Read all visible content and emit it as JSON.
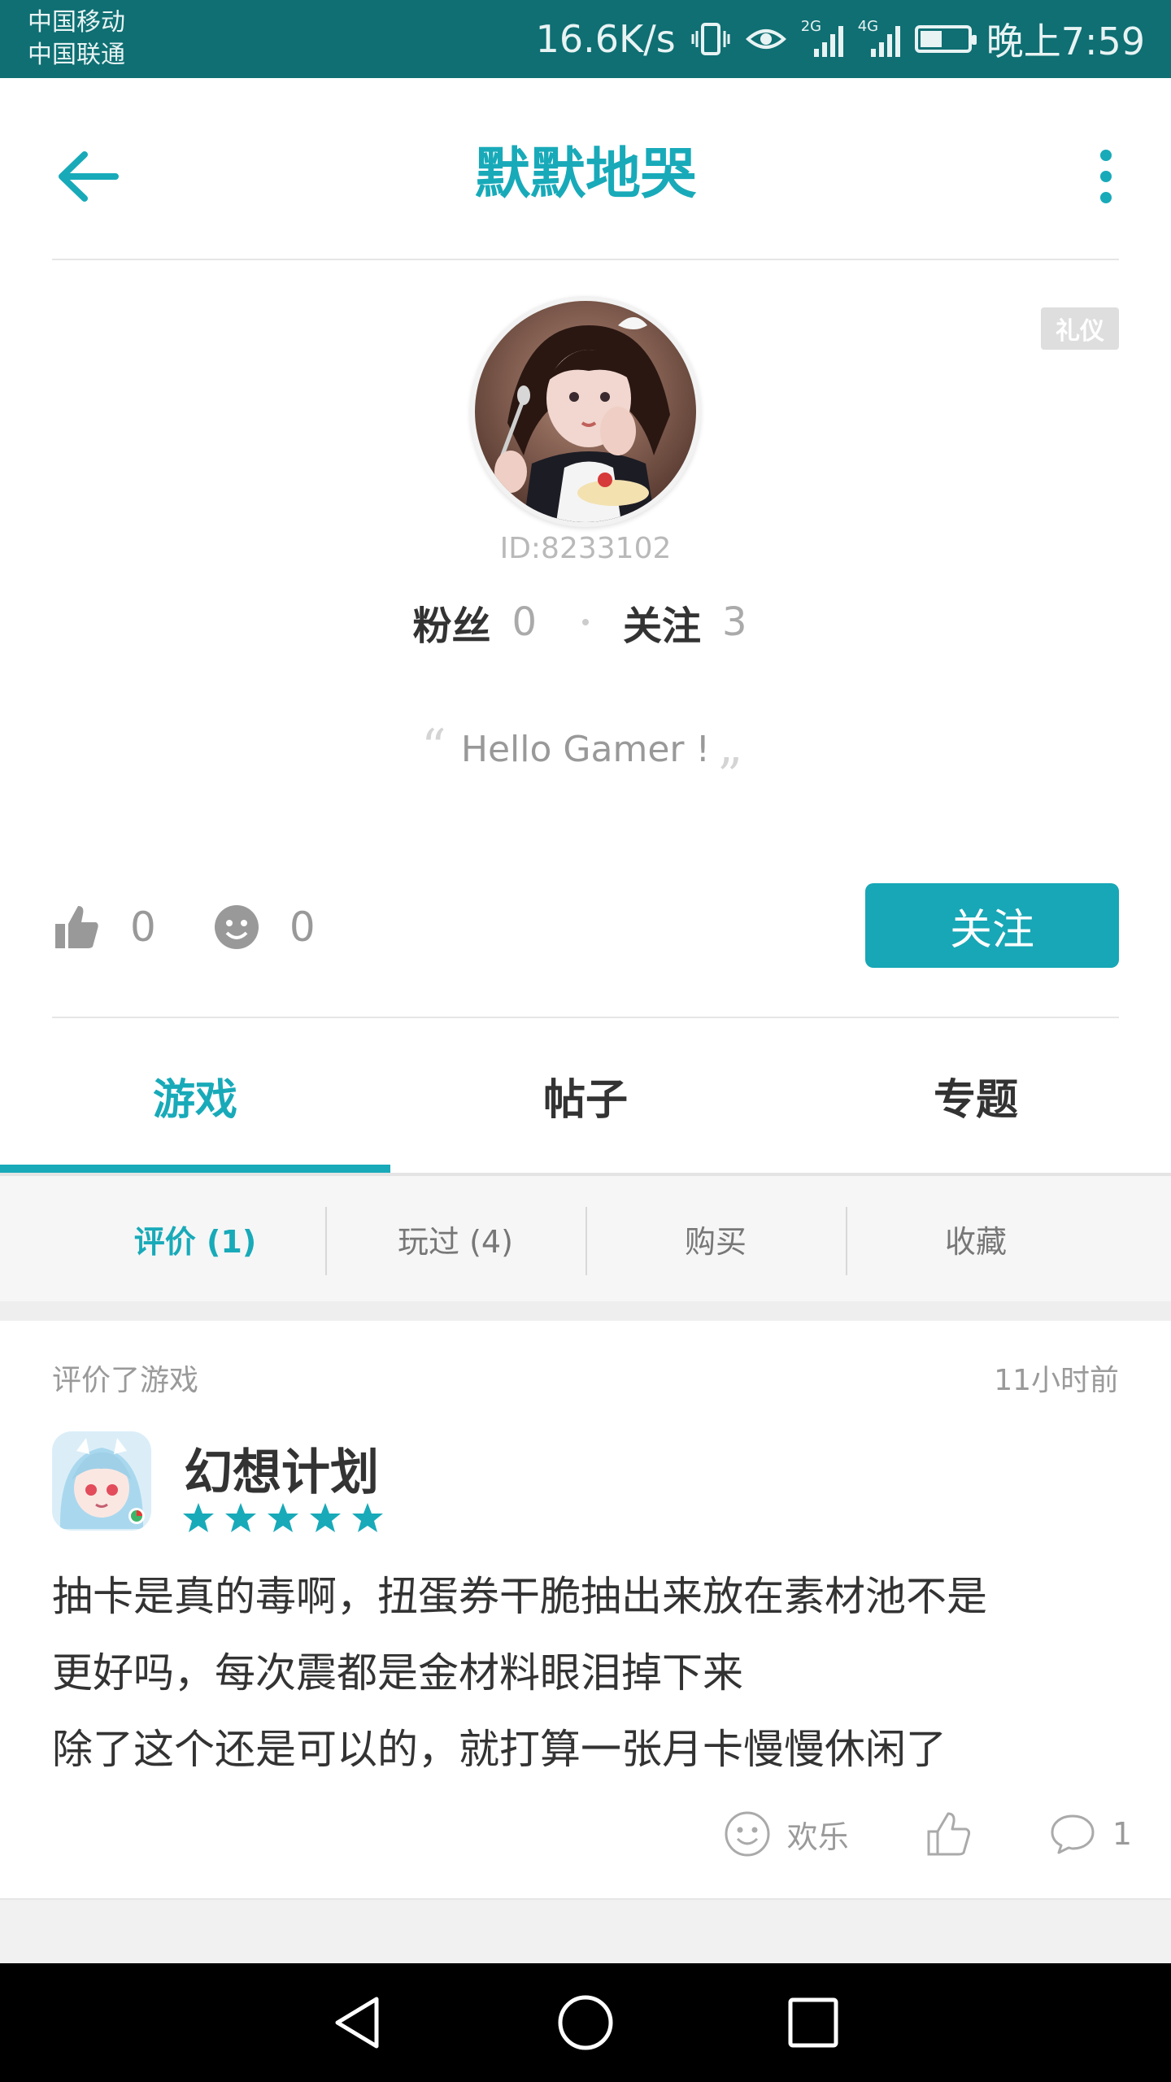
{
  "status_bar": {
    "carrier_1": "中国移动",
    "carrier_2": "中国联通",
    "speed": "16.6K/s",
    "network_1": "2G",
    "network_2": "4G",
    "time": "晚上7:59"
  },
  "header": {
    "title": "默默地哭"
  },
  "profile": {
    "badge": "礼仪",
    "user_id": "ID:8233102",
    "fans_label": "粉丝",
    "fans_count": "0",
    "following_label": "关注",
    "following_count": "3",
    "signature": "Hello Gamer !",
    "likes_count": "0",
    "emoji_count": "0",
    "follow_button": "关注"
  },
  "tabs": [
    {
      "label": "游戏",
      "active": true
    },
    {
      "label": "帖子",
      "active": false
    },
    {
      "label": "专题",
      "active": false
    }
  ],
  "subtabs": [
    {
      "label": "评价 (1)",
      "active": true
    },
    {
      "label": "玩过 (4)",
      "active": false
    },
    {
      "label": "购买",
      "active": false
    },
    {
      "label": "收藏",
      "active": false
    }
  ],
  "review": {
    "action_label": "评价了游戏",
    "time_ago": "11小时前",
    "game_name": "幻想计划",
    "rating": 5,
    "text_lines": [
      "抽卡是真的毒啊，扭蛋券干脆抽出来放在素材池不是",
      "更好吗，每次震都是金材料眼泪掉下来",
      "除了这个还是可以的，就打算一张月卡慢慢休闲了"
    ],
    "mood_label": "欢乐",
    "comment_count": "1"
  },
  "colors": {
    "accent": "#18aab9",
    "status_bar": "#0f6f73"
  }
}
